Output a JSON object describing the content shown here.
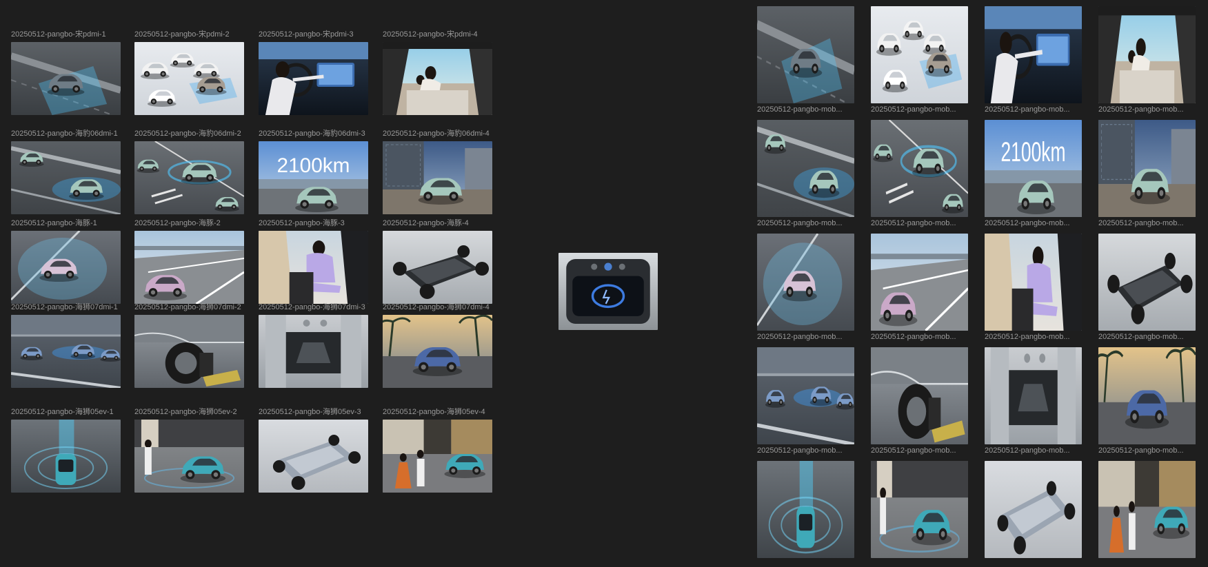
{
  "canvas": {
    "background": "#1e1e1e"
  },
  "left_grid": {
    "rows": [
      {
        "items": [
          {
            "label": "20250512-pangbo-宋pdmi-1",
            "scene": "highway-sensor"
          },
          {
            "label": "20250512-pangbo-宋pdmi-2",
            "scene": "parking-lot"
          },
          {
            "label": "20250512-pangbo-宋pdmi-3",
            "scene": "interior-driver"
          },
          {
            "label": "20250512-pangbo-宋pdmi-4",
            "scene": "interior-family"
          }
        ]
      },
      {
        "items": [
          {
            "label": "20250512-pangbo-海豹06dmi-1",
            "scene": "highway-sensor-green"
          },
          {
            "label": "20250512-pangbo-海豹06dmi-2",
            "scene": "parking-green"
          },
          {
            "label": "20250512-pangbo-海豹06dmi-3",
            "scene": "range-2100km",
            "overlay": "2100km"
          },
          {
            "label": "20250512-pangbo-海豹06dmi-4",
            "scene": "city-green"
          }
        ]
      },
      {
        "items": [
          {
            "label": "20250512-pangbo-海豚-1",
            "scene": "sensor-dome-pink"
          },
          {
            "label": "20250512-pangbo-海豚-2",
            "scene": "bridge-pink"
          },
          {
            "label": "20250512-pangbo-海豚-3",
            "scene": "interior-lavender"
          },
          {
            "label": "20250512-pangbo-海豚-4",
            "scene": "chassis"
          }
        ]
      },
      {
        "items": [
          {
            "label": "20250512-pangbo-海狮07dmi-1",
            "scene": "highway-blue"
          },
          {
            "label": "20250512-pangbo-海狮07dmi-2",
            "scene": "suspension"
          },
          {
            "label": "20250512-pangbo-海狮07dmi-3",
            "scene": "underbody"
          },
          {
            "label": "20250512-pangbo-海狮07dmi-4",
            "scene": "sunset-palm"
          }
        ]
      },
      {
        "items": [
          {
            "label": "20250512-pangbo-海狮05ev-1",
            "scene": "topdown-teal"
          },
          {
            "label": "20250512-pangbo-海狮05ev-2",
            "scene": "woman-teal"
          },
          {
            "label": "20250512-pangbo-海狮05ev-3",
            "scene": "chassis-light"
          },
          {
            "label": "20250512-pangbo-海狮05ev-4",
            "scene": "couple-teal"
          }
        ]
      }
    ],
    "extra": {
      "scene": "wireless-charger"
    }
  },
  "right_grid": {
    "rows": [
      {
        "items": [
          {
            "label": "20250512-pangbo-mob...",
            "scene": "highway-sensor"
          },
          {
            "label": "20250512-pangbo-mob...",
            "scene": "parking-lot"
          },
          {
            "label": "20250512-pangbo-mob...",
            "scene": "interior-driver"
          },
          {
            "label": "20250512-pangbo-mob...",
            "scene": "interior-family"
          }
        ]
      },
      {
        "items": [
          {
            "label": "20250512-pangbo-mob...",
            "scene": "highway-sensor-green"
          },
          {
            "label": "20250512-pangbo-mob...",
            "scene": "parking-green"
          },
          {
            "label": "20250512-pangbo-mob...",
            "scene": "range-2100km",
            "overlay": "2100km"
          },
          {
            "label": "20250512-pangbo-mob...",
            "scene": "city-green"
          }
        ]
      },
      {
        "items": [
          {
            "label": "20250512-pangbo-mob...",
            "scene": "sensor-dome-pink"
          },
          {
            "label": "20250512-pangbo-mob...",
            "scene": "bridge-pink"
          },
          {
            "label": "20250512-pangbo-mob...",
            "scene": "interior-lavender"
          },
          {
            "label": "20250512-pangbo-mob...",
            "scene": "chassis"
          }
        ]
      },
      {
        "items": [
          {
            "label": "20250512-pangbo-mob...",
            "scene": "highway-blue"
          },
          {
            "label": "20250512-pangbo-mob...",
            "scene": "suspension"
          },
          {
            "label": "20250512-pangbo-mob...",
            "scene": "underbody"
          },
          {
            "label": "20250512-pangbo-mob...",
            "scene": "sunset-palm"
          }
        ]
      },
      {
        "items": [
          {
            "label": "",
            "scene": "topdown-teal"
          },
          {
            "label": "",
            "scene": "woman-teal"
          },
          {
            "label": "",
            "scene": "chassis-light"
          },
          {
            "label": "",
            "scene": "couple-teal"
          }
        ]
      }
    ]
  }
}
